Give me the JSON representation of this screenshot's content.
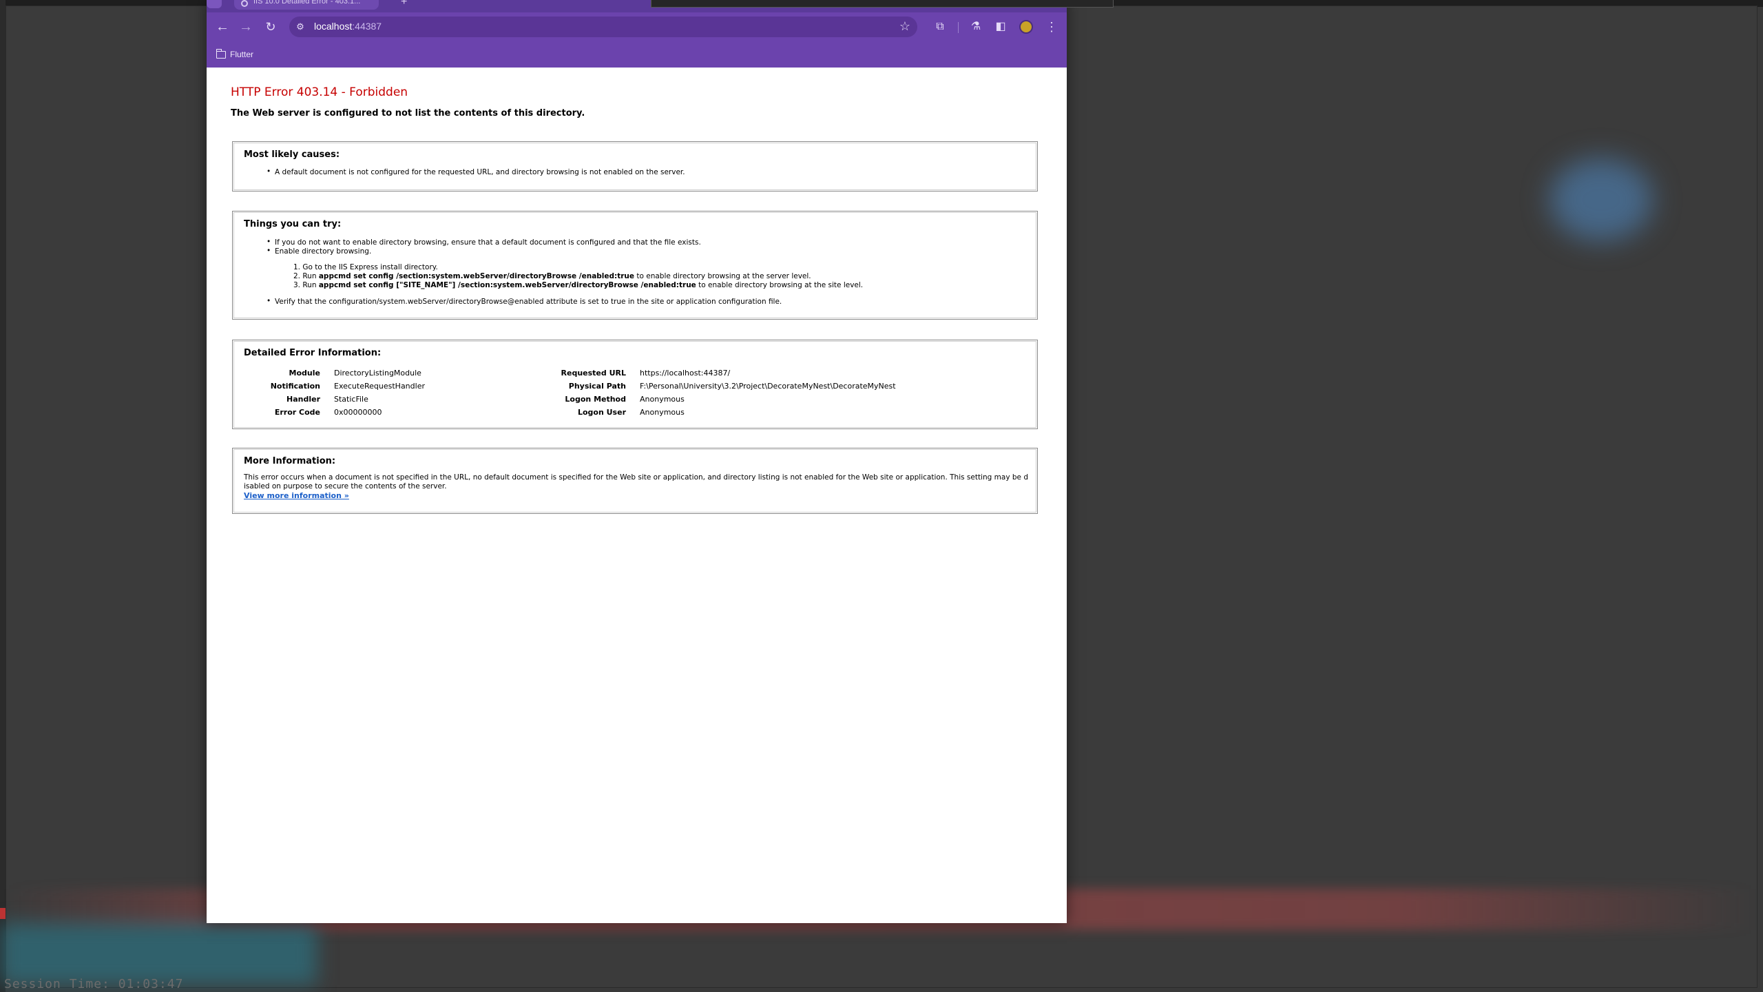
{
  "browser": {
    "tab_title": "IIS 10.0 Detailed Error - 403.1...",
    "new_tab_label": "+",
    "url_host": "localhost",
    "url_port": ":44387",
    "bookmark": "Flutter"
  },
  "icons": {
    "back": "←",
    "forward": "→",
    "reload": "↻",
    "site_info": "⚙",
    "star": "☆",
    "extensions": "⧉",
    "labs": "⚗",
    "sidepanel": "◧",
    "menu": "⋮"
  },
  "error": {
    "title": "HTTP Error 403.14 - Forbidden",
    "subtitle": "The Web server is configured to not list the contents of this directory."
  },
  "causes": {
    "heading": "Most likely causes:",
    "items": [
      "A default document is not configured for the requested URL, and directory browsing is not enabled on the server."
    ]
  },
  "try": {
    "heading": "Things you can try:",
    "item1": "If you do not want to enable directory browsing, ensure that a default document is configured and that the file exists.",
    "item2": "Enable directory browsing.",
    "step1": "Go to the IIS Express install directory.",
    "step2_pre": "Run ",
    "step2_cmd": "appcmd set config /section:system.webServer/directoryBrowse /enabled:true",
    "step2_post": " to enable directory browsing at the server level.",
    "step3_pre": "Run ",
    "step3_cmd": "appcmd set config [\"SITE_NAME\"] /section:system.webServer/directoryBrowse /enabled:true",
    "step3_post": " to enable directory browsing at the site level.",
    "item3": "Verify that the configuration/system.webServer/directoryBrowse@enabled attribute is set to true in the site or application configuration file."
  },
  "details": {
    "heading": "Detailed Error Information:",
    "left": [
      {
        "label": "Module",
        "value": "DirectoryListingModule"
      },
      {
        "label": "Notification",
        "value": "ExecuteRequestHandler"
      },
      {
        "label": "Handler",
        "value": "StaticFile"
      },
      {
        "label": "Error Code",
        "value": "0x00000000"
      }
    ],
    "right": [
      {
        "label": "Requested URL",
        "value": "https://localhost:44387/"
      },
      {
        "label": "Physical Path",
        "value": "F:\\Personal\\University\\3.2\\Project\\DecorateMyNest\\DecorateMyNest"
      },
      {
        "label": "Logon Method",
        "value": "Anonymous"
      },
      {
        "label": "Logon User",
        "value": "Anonymous"
      }
    ]
  },
  "more": {
    "heading": "More Information:",
    "text": "This error occurs when a document is not specified in the URL, no default document is specified for the Web site or application, and directory listing is not enabled for the Web site or application. This setting may be disabled on purpose to secure the contents of the server.",
    "link": "View more information »"
  },
  "desktop": {
    "status": "Session Time: 01:03:47"
  }
}
